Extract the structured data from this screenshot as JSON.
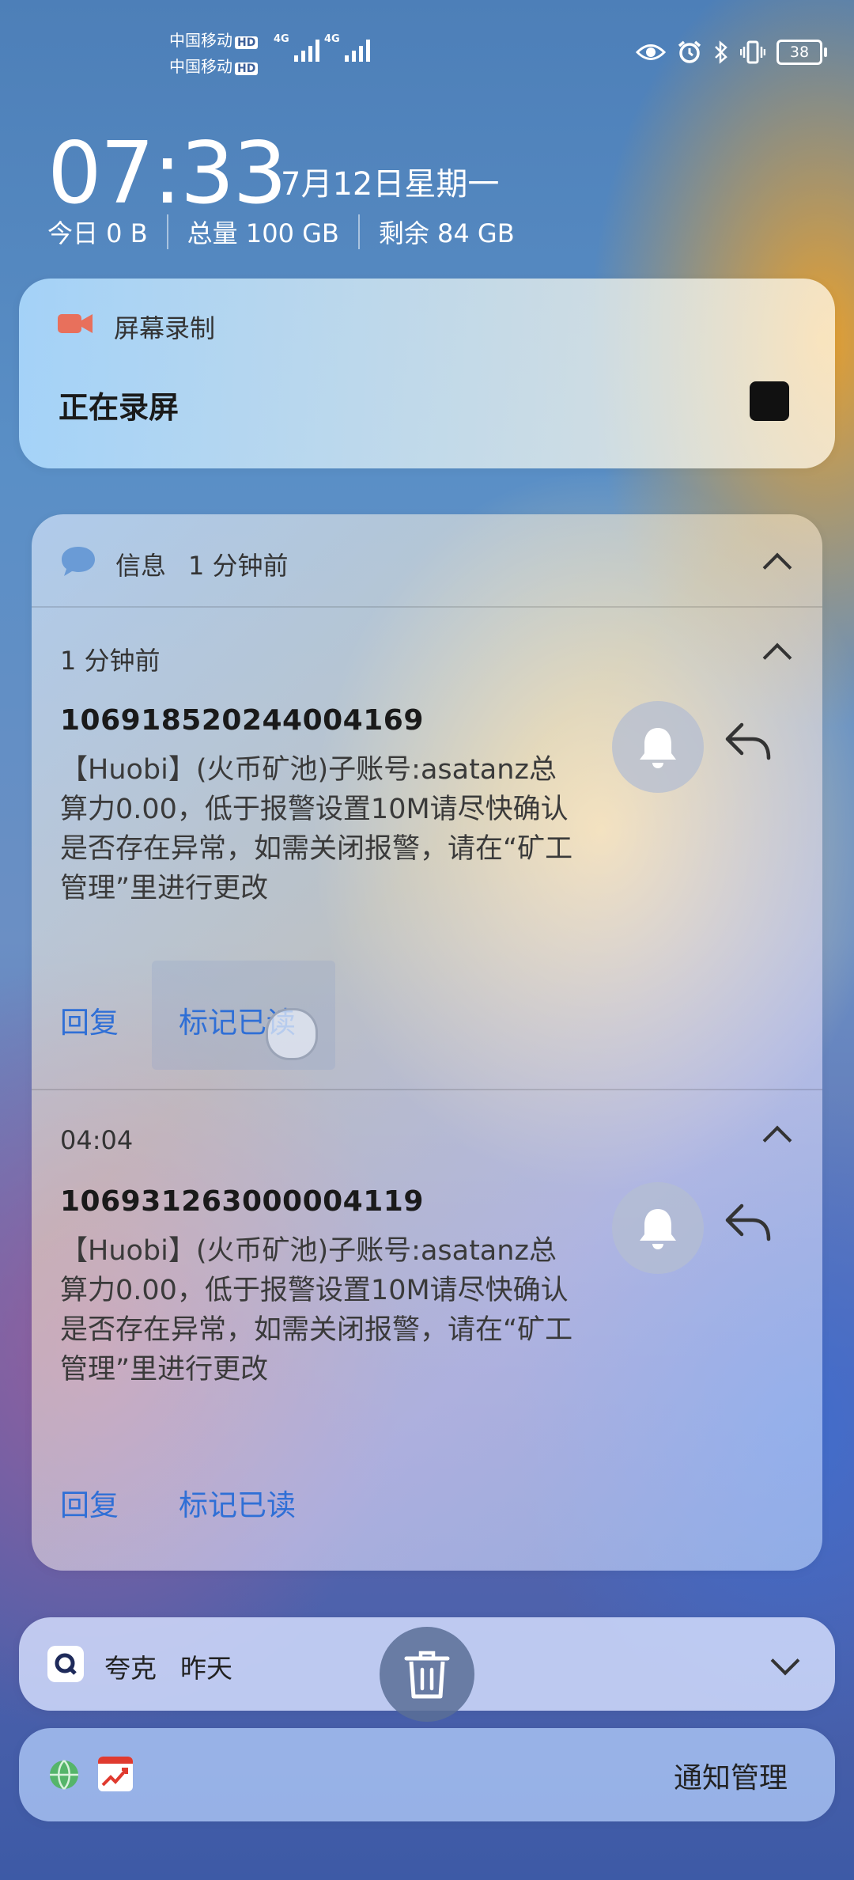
{
  "status_bar": {
    "carrier1": "中国移动",
    "carrier2": "中国移动",
    "hd_badge": "HD",
    "network_type": "4G",
    "battery": "38"
  },
  "lock": {
    "time": "07:33",
    "date": "7月12日星期一",
    "data_today": "今日 0 B",
    "data_total": "总量 100 GB",
    "data_remaining": "剩余 84 GB"
  },
  "screen_record": {
    "app_name": "屏幕录制",
    "status": "正在录屏"
  },
  "messages_group": {
    "app_name": "信息",
    "time": "1 分钟前",
    "items": [
      {
        "time": "1 分钟前",
        "sender": "10691852024400416​9",
        "body": "【Huobi】(火币矿池)子账号:asatanz总算力0.00，低于报警设置10M请尽快确认是否存在异常，如需关闭报警，请在“矿工管理”里进行更改",
        "reply_label": "回复",
        "mark_read_label": "标记已读"
      },
      {
        "time": "04:04",
        "sender": "1069312630000041​19",
        "body": "【Huobi】(火币矿池)子账号:asatanz总算力0.00，低于报警设置10M请尽快确认是否存在异常，如需关闭报警，请在“矿工管理”里进行更改",
        "reply_label": "回复",
        "mark_read_label": "标记已读"
      }
    ]
  },
  "quark": {
    "app_name": "夸克",
    "time": "昨天"
  },
  "bottom": {
    "manage_label": "通知管理"
  },
  "colors": {
    "accent": "#2f6fd6",
    "record_icon": "#e8705c"
  }
}
